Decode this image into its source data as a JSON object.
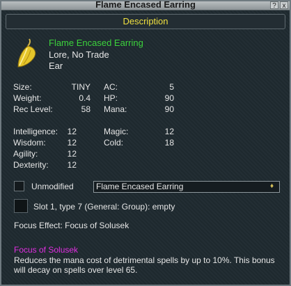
{
  "window": {
    "title": "Flame Encased Earring",
    "help_btn": "?",
    "close_btn": "x"
  },
  "header": {
    "label": "Description"
  },
  "item": {
    "name": "Flame Encased Earring",
    "flags": "Lore, No Trade",
    "slot": "Ear"
  },
  "stats_left": [
    {
      "label": "Size:",
      "value": "TINY"
    },
    {
      "label": "Weight:",
      "value": "0.4"
    },
    {
      "label": "Rec Level:",
      "value": "58"
    }
  ],
  "stats_mid": [
    {
      "label": "AC:",
      "value": "5"
    },
    {
      "label": "HP:",
      "value": "90"
    },
    {
      "label": "Mana:",
      "value": "90"
    }
  ],
  "attributes": [
    {
      "label": "Intelligence:",
      "value": "12"
    },
    {
      "label": "Wisdom:",
      "value": "12"
    },
    {
      "label": "Agility:",
      "value": "12"
    },
    {
      "label": "Dexterity:",
      "value": "12"
    }
  ],
  "resists": [
    {
      "label": "Magic:",
      "value": "12"
    },
    {
      "label": "Cold:",
      "value": "18"
    }
  ],
  "modifier": {
    "checkbox_label": "Unmodified",
    "selected": "Flame Encased Earring"
  },
  "slot_info": "Slot 1, type 7 (General: Group): empty",
  "focus_effect": "Focus Effect: Focus of Solusek",
  "focus": {
    "name": "Focus of Solusek",
    "description": "Reduces the mana cost of detrimental spells by up to 10%. This bonus will decay on spells over level 65."
  }
}
